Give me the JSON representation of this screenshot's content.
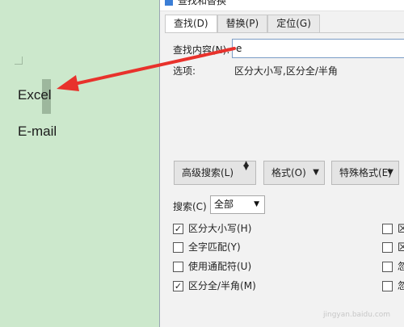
{
  "document": {
    "lines": [
      "Excel",
      "E-mail"
    ]
  },
  "dialog": {
    "title": "查找和替换",
    "tabs": [
      {
        "label": "查找(D)",
        "active": true
      },
      {
        "label": "替换(P)",
        "active": false
      },
      {
        "label": "定位(G)",
        "active": false
      }
    ],
    "find": {
      "label": "查找内容(N):",
      "value": "e"
    },
    "options": {
      "label": "选项:",
      "value": "区分大小写,区分全/半角"
    },
    "buttons": {
      "advanced": "高级搜索(L)",
      "format": "格式(O)",
      "special": "特殊格式(E)"
    },
    "search": {
      "label": "搜索(C)",
      "selected": "全部"
    },
    "checkboxes_left": [
      {
        "label": "区分大小写(H)",
        "checked": true
      },
      {
        "label": "全字匹配(Y)",
        "checked": false
      },
      {
        "label": "使用通配符(U)",
        "checked": false
      },
      {
        "label": "区分全/半角(M)",
        "checked": true
      }
    ],
    "checkboxes_right": [
      {
        "label": "区",
        "checked": false
      },
      {
        "label": "区",
        "checked": false
      },
      {
        "label": "忽",
        "checked": false
      },
      {
        "label": "忽",
        "checked": false
      }
    ]
  },
  "icons": {
    "check": "✓",
    "dropdown": "▼",
    "updown": "updown-arrows-icon"
  },
  "colors": {
    "doc_bg": "#cce8cc",
    "arrow": "#e8322c",
    "dialog_bg": "#f2f2f2"
  },
  "watermark": "jingyan.baidu.com"
}
